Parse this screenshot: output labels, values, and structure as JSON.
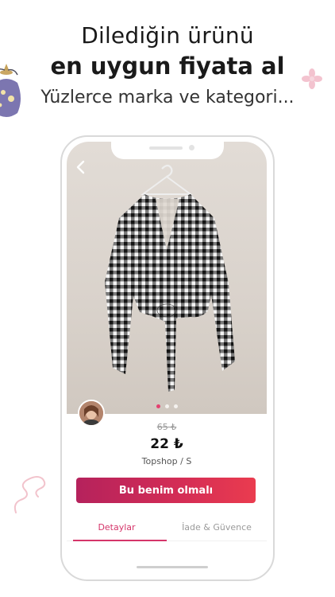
{
  "headline": {
    "line1": "Dilediğin ürünü",
    "line2": "en uygun fiyata al",
    "line3": "Yüzlerce marka ve kategori..."
  },
  "product": {
    "old_price": "65 ₺",
    "price": "22 ₺",
    "brand_size": "Topshop / S",
    "image_index": 1,
    "image_count": 3
  },
  "actions": {
    "buy_label": "Bu benim olmalı"
  },
  "tabs": [
    {
      "label": "Detaylar",
      "active": true
    },
    {
      "label": "İade & Güvence",
      "active": false
    }
  ],
  "colors": {
    "accent": "#d5356a",
    "cta_start": "#b5225c",
    "cta_end": "#ea3c4f"
  },
  "icons": {
    "back": "chevron-left-icon"
  }
}
